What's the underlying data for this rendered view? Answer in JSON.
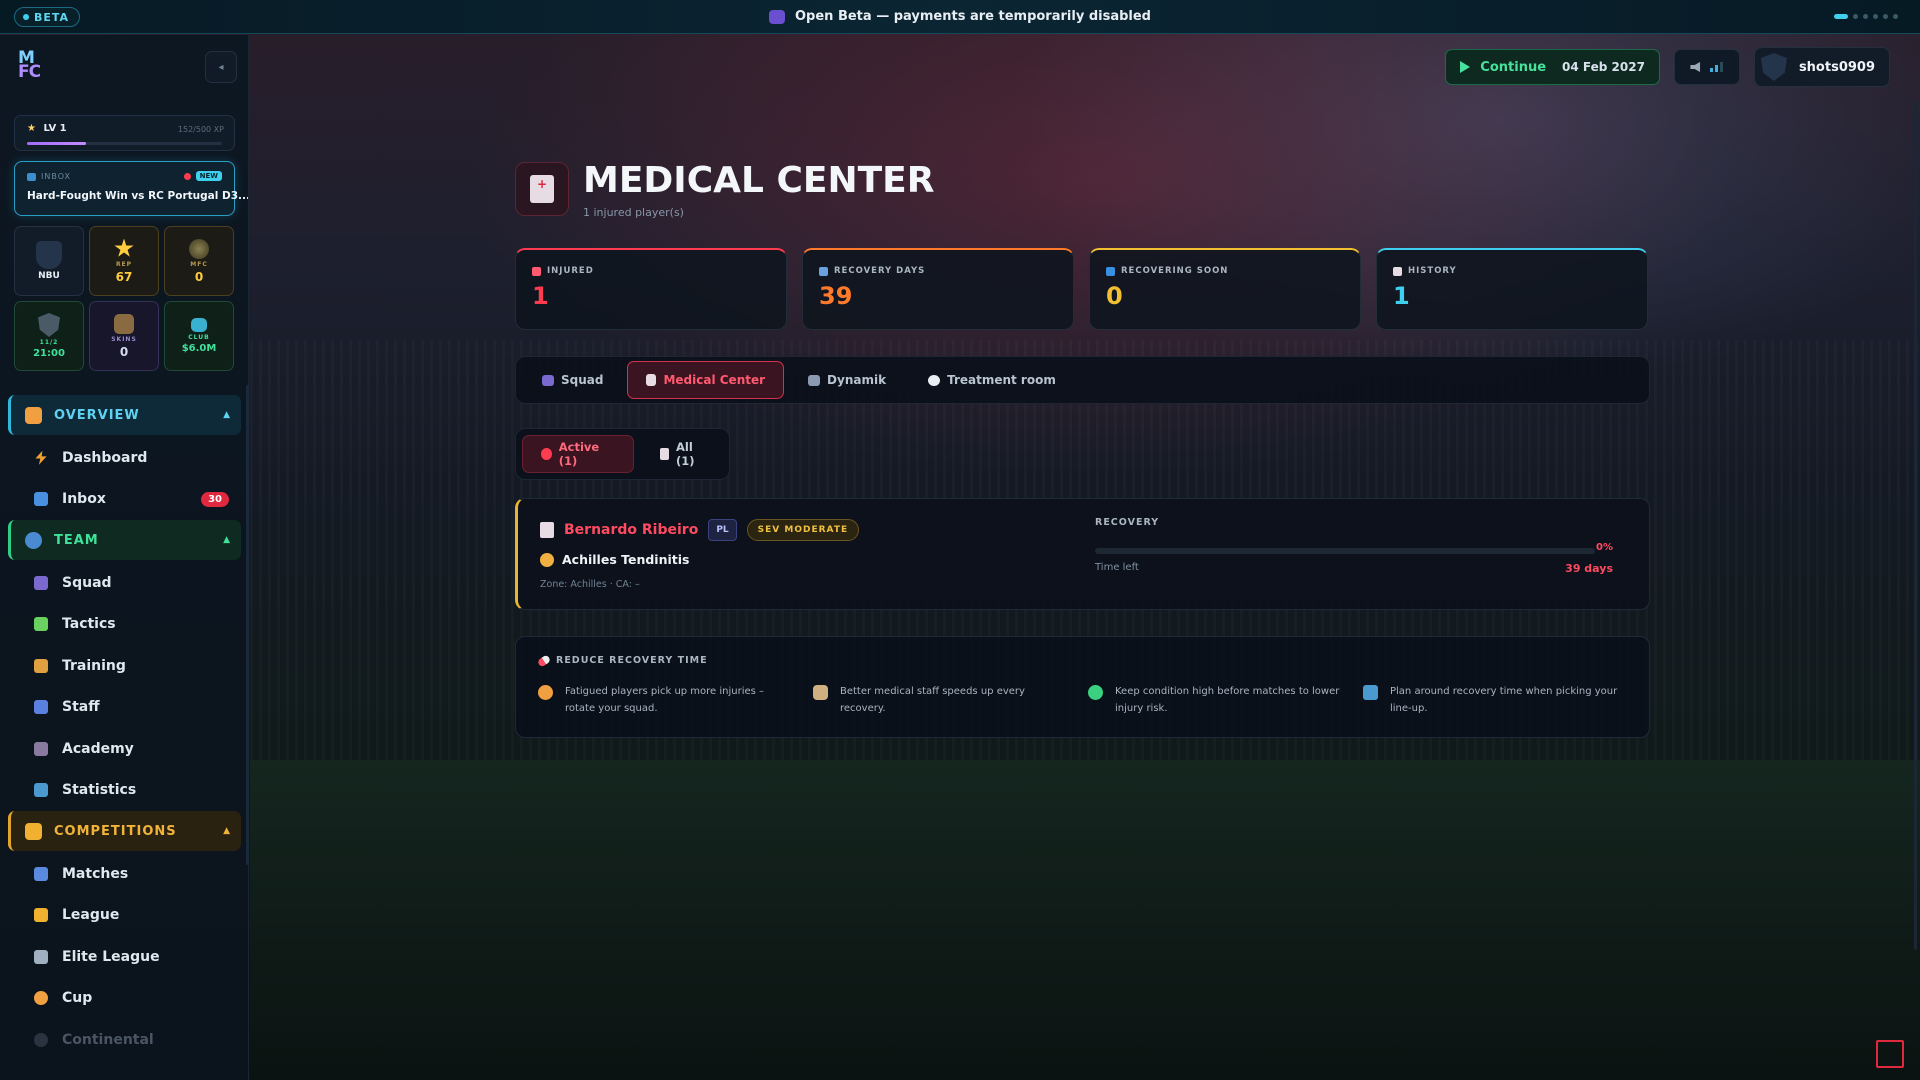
{
  "topbar": {
    "beta_label": "BETA",
    "message": "Open Beta — payments are temporarily disabled"
  },
  "sidebar": {
    "logo_line1": "M",
    "logo_line2": "FC",
    "level": {
      "label": "LV 1",
      "xp": "152/500 XP",
      "progress": 0.304
    },
    "inbox": {
      "label": "INBOX",
      "badge": "NEW",
      "subject": "Hard-Fought Win vs RC Portugal D3..."
    },
    "tiles": [
      {
        "label": "",
        "value": "NBU",
        "icon": "shield-icon"
      },
      {
        "label": "REP",
        "value": "67",
        "icon": "star-icon"
      },
      {
        "label": "MFC",
        "value": "0",
        "icon": "coin-icon"
      },
      {
        "label": "11/2",
        "value": "21:00",
        "icon": "shield-icon"
      },
      {
        "label": "SKINS",
        "value": "0",
        "icon": "kit-icon"
      },
      {
        "label": "CLUB",
        "value": "$6.0M",
        "icon": "money-icon"
      }
    ],
    "sections": [
      {
        "title": "OVERVIEW",
        "items": [
          {
            "label": "Dashboard",
            "icon": "lightning-icon"
          },
          {
            "label": "Inbox",
            "icon": "inbox-icon",
            "count": "30"
          }
        ]
      },
      {
        "title": "TEAM",
        "items": [
          {
            "label": "Squad",
            "icon": "people-icon"
          },
          {
            "label": "Tactics",
            "icon": "puzzle-icon"
          },
          {
            "label": "Training",
            "icon": "runner-icon"
          },
          {
            "label": "Staff",
            "icon": "staff-icon"
          },
          {
            "label": "Academy",
            "icon": "academy-icon"
          },
          {
            "label": "Statistics",
            "icon": "chart-icon"
          }
        ]
      },
      {
        "title": "COMPETITIONS",
        "items": [
          {
            "label": "Matches",
            "icon": "calendar-icon"
          },
          {
            "label": "League",
            "icon": "trophy-icon"
          },
          {
            "label": "Elite League",
            "icon": "swords-icon"
          },
          {
            "label": "Cup",
            "icon": "medal-icon"
          },
          {
            "label": "Continental",
            "icon": "globe-icon"
          }
        ]
      }
    ]
  },
  "header": {
    "continue_label": "Continue",
    "date": "04 Feb 2027",
    "username": "shots0909"
  },
  "page": {
    "title": "MEDICAL CENTER",
    "subtitle": "1 injured player(s)"
  },
  "stats": [
    {
      "label": "INJURED",
      "value": "1",
      "color": "#ff3b4f"
    },
    {
      "label": "RECOVERY DAYS",
      "value": "39",
      "color": "#ff7a2a"
    },
    {
      "label": "RECOVERING SOON",
      "value": "0",
      "color": "#f0c030"
    },
    {
      "label": "HISTORY",
      "value": "1",
      "color": "#3fd0f0"
    }
  ],
  "tabs": [
    {
      "label": "Squad",
      "icon": "people-icon"
    },
    {
      "label": "Medical Center",
      "icon": "medkit-icon",
      "active": true
    },
    {
      "label": "Dynamik",
      "icon": "stadium-icon"
    },
    {
      "label": "Treatment room",
      "icon": "chat-icon"
    }
  ],
  "filters": [
    {
      "label": "Active (1)",
      "active": true
    },
    {
      "label": "All (1)"
    }
  ],
  "injury": {
    "player": "Bernardo Ribeiro",
    "position": "PL",
    "severity": "SEV MODERATE",
    "injury": "Achilles Tendinitis",
    "zone": "Zone: Achilles · CA: –",
    "recovery_label": "RECOVERY",
    "recovery_pct": "0%",
    "recovery_progress": 0,
    "time_left_label": "Time left",
    "time_left": "39 days"
  },
  "tips": {
    "title": "REDUCE RECOVERY TIME",
    "items": [
      {
        "text": "Fatigued players pick up more injuries – rotate your squad.",
        "icon": "tired-face-icon"
      },
      {
        "text": "Better medical staff speeds up every recovery.",
        "icon": "doctor-icon"
      },
      {
        "text": "Keep condition high before matches to lower injury risk.",
        "icon": "green-circle-icon"
      },
      {
        "text": "Plan around recovery time when picking your line-up.",
        "icon": "chart-icon"
      }
    ]
  }
}
